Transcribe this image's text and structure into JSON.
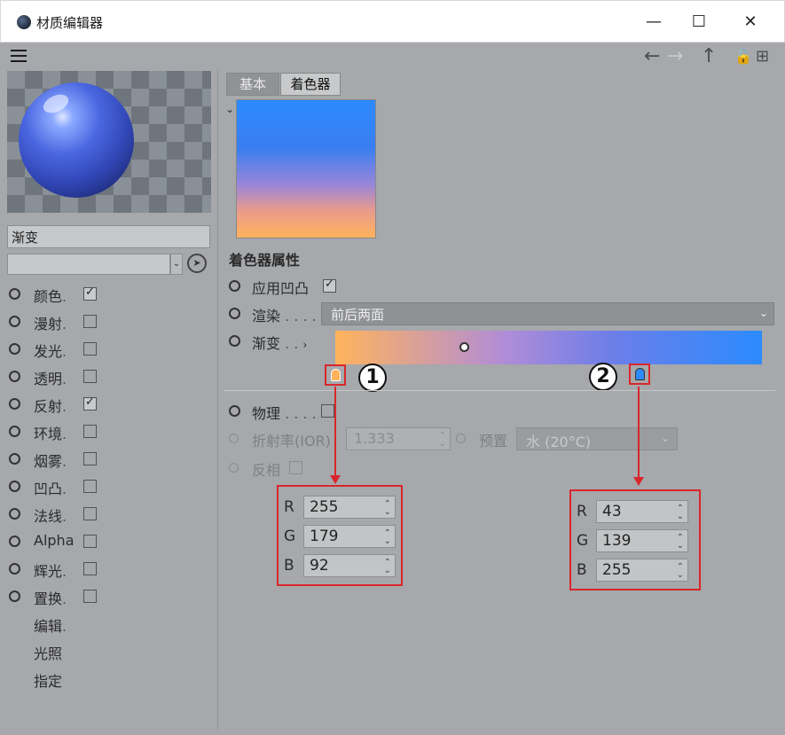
{
  "window": {
    "title": "材质编辑器",
    "minimize": "—",
    "maximize": "☐",
    "close": "✕"
  },
  "toolbar": {
    "back": "←",
    "forward": "→",
    "up": "↑",
    "lock": "🔓",
    "new": "⊞"
  },
  "left": {
    "material_name": "渐变",
    "channels": [
      {
        "label": "颜色",
        "checked": true
      },
      {
        "label": "漫射",
        "checked": false
      },
      {
        "label": "发光",
        "checked": false
      },
      {
        "label": "透明",
        "checked": false
      },
      {
        "label": "反射",
        "checked": true
      },
      {
        "label": "环境",
        "checked": false
      },
      {
        "label": "烟雾",
        "checked": false
      },
      {
        "label": "凹凸",
        "checked": false
      },
      {
        "label": "法线",
        "checked": false
      },
      {
        "label": "Alpha",
        "checked": false
      },
      {
        "label": "辉光",
        "checked": false
      },
      {
        "label": "置换",
        "checked": false
      }
    ],
    "extra_items": [
      "编辑",
      "光照",
      "指定"
    ]
  },
  "tabs": {
    "basic": "基本",
    "shader": "着色器"
  },
  "shader": {
    "section_title": "着色器属性",
    "use_bump": "应用凹凸",
    "render_label": "渲染",
    "render_value": "前后两面",
    "gradient_label": "渐变",
    "physical_label": "物理",
    "ior_label": "折射率(IOR)",
    "ior_value": "1.333",
    "preset_label": "预置",
    "preset_value": "水 (20°C)",
    "invert_label": "反相"
  },
  "annotations": {
    "knot1": "1",
    "knot2": "2",
    "knot1_color": {
      "R": "255",
      "G": "179",
      "B": "92"
    },
    "knot2_color": {
      "R": "43",
      "G": "139",
      "B": "255"
    }
  },
  "colors": {
    "accent_red": "#d9262c",
    "gradient_start": "#ffb35c",
    "gradient_end": "#2b8bff"
  }
}
